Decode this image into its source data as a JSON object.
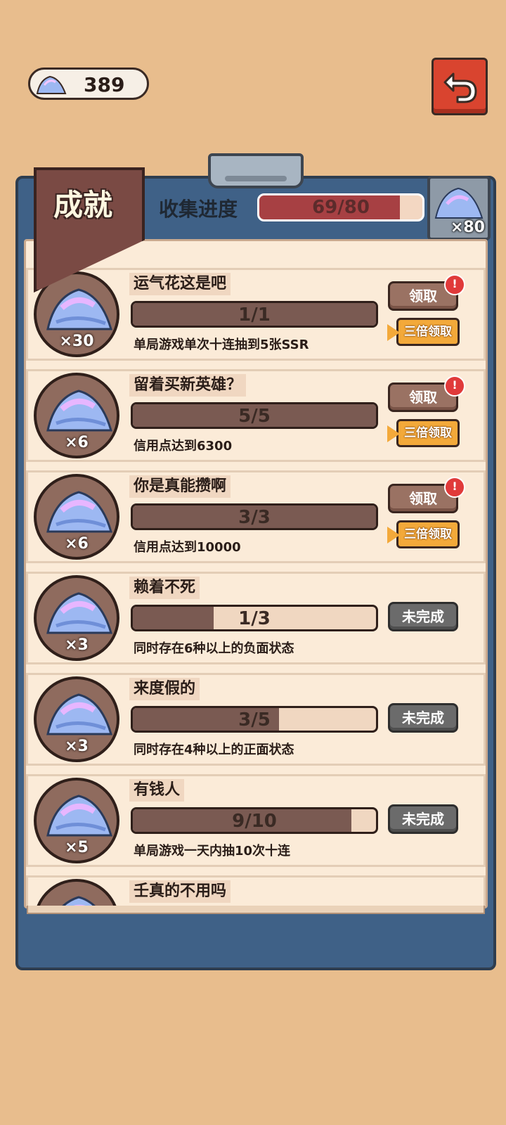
{
  "currency": {
    "amount": "389",
    "icon": "crystal-icon"
  },
  "header": {
    "banner_title": "成就",
    "collect_label": "收集进度",
    "collect_progress": "69/80",
    "collect_fraction": 0.8625,
    "reward_count": "×80"
  },
  "colors": {
    "background": "#e8bd8d",
    "board": "#3f6187",
    "paper": "#fbebd8",
    "bar_fill": "#7a5a52",
    "red_bar": "#a74043",
    "gold": "#f3a93a"
  },
  "achievements": [
    {
      "title": "运气花这是吧",
      "progress": "1/1",
      "fraction": 1.0,
      "desc": "单局游戏单次十连抽到5张SSR",
      "reward": "×30",
      "claimable": true,
      "claim": "领取",
      "triple": "三倍领取"
    },
    {
      "title": "留着买新英雄？",
      "progress": "5/5",
      "fraction": 1.0,
      "desc": "信用点达到6300",
      "reward": "×6",
      "claimable": true,
      "claim": "领取",
      "triple": "三倍领取"
    },
    {
      "title": "你是真能攒啊",
      "progress": "3/3",
      "fraction": 1.0,
      "desc": "信用点达到10000",
      "reward": "×6",
      "claimable": true,
      "claim": "领取",
      "triple": "三倍领取"
    },
    {
      "title": "赖着不死",
      "progress": "1/3",
      "fraction": 0.333,
      "desc": "同时存在6种以上的负面状态",
      "reward": "×3",
      "claimable": false,
      "status": "未完成"
    },
    {
      "title": "来度假的",
      "progress": "3/5",
      "fraction": 0.6,
      "desc": "同时存在4种以上的正面状态",
      "reward": "×3",
      "claimable": false,
      "status": "未完成"
    },
    {
      "title": "有钱人",
      "progress": "9/10",
      "fraction": 0.9,
      "desc": "单局游戏一天内抽10次十连",
      "reward": "×5",
      "claimable": false,
      "status": "未完成"
    },
    {
      "title": "壬真的不用吗",
      "progress": "",
      "fraction": 0,
      "desc": "",
      "reward": "",
      "claimable": false,
      "status": ""
    }
  ]
}
